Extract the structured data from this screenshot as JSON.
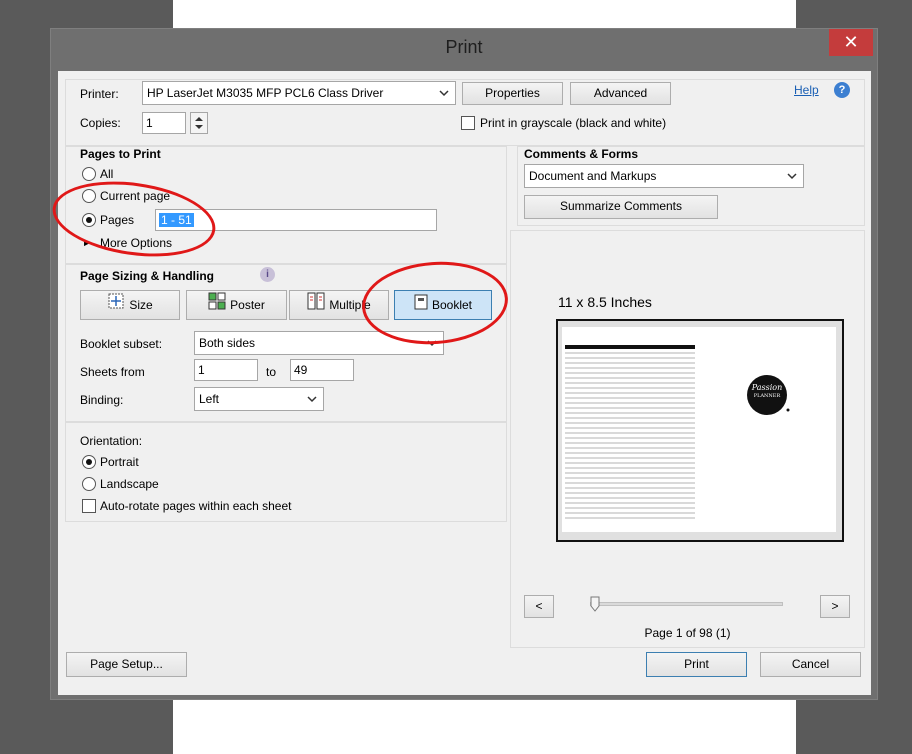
{
  "dialog": {
    "title": "Print",
    "close_glyph": "✕"
  },
  "printer": {
    "label": "Printer:",
    "selected": "HP LaserJet M3035 MFP PCL6 Class Driver",
    "properties": "Properties",
    "advanced": "Advanced",
    "help": "Help",
    "copies_label": "Copies:",
    "copies_value": "1",
    "grayscale": "Print in grayscale (black and white)"
  },
  "pages_to_print": {
    "heading": "Pages to Print",
    "all": "All",
    "current": "Current page",
    "pages": "Pages",
    "pages_value": "1 - 51",
    "more_options": "More Options"
  },
  "sizing": {
    "heading": "Page Sizing & Handling",
    "size": "Size",
    "poster": "Poster",
    "multiple": "Multiple",
    "booklet": "Booklet",
    "subset_label": "Booklet subset:",
    "subset_value": "Both sides",
    "sheets_label": "Sheets from",
    "sheets_from": "1",
    "to_label": "to",
    "sheets_to": "49",
    "binding_label": "Binding:",
    "binding_value": "Left"
  },
  "orientation": {
    "heading": "Orientation:",
    "portrait": "Portrait",
    "landscape": "Landscape",
    "autorotate": "Auto-rotate pages within each sheet"
  },
  "comments": {
    "heading": "Comments & Forms",
    "selected": "Document and Markups",
    "summarize": "Summarize Comments"
  },
  "preview": {
    "size_text": "11 x 8.5 Inches",
    "logo_line1": "Passion",
    "logo_line2": "PLANNER",
    "page_status": "Page 1 of 98 (1)",
    "prev": "<",
    "next": ">"
  },
  "footer": {
    "page_setup": "Page Setup...",
    "print": "Print",
    "cancel": "Cancel"
  },
  "colors": {
    "annotation": "#e01818",
    "accent": "#3c7fb1",
    "close": "#c43c3c"
  }
}
